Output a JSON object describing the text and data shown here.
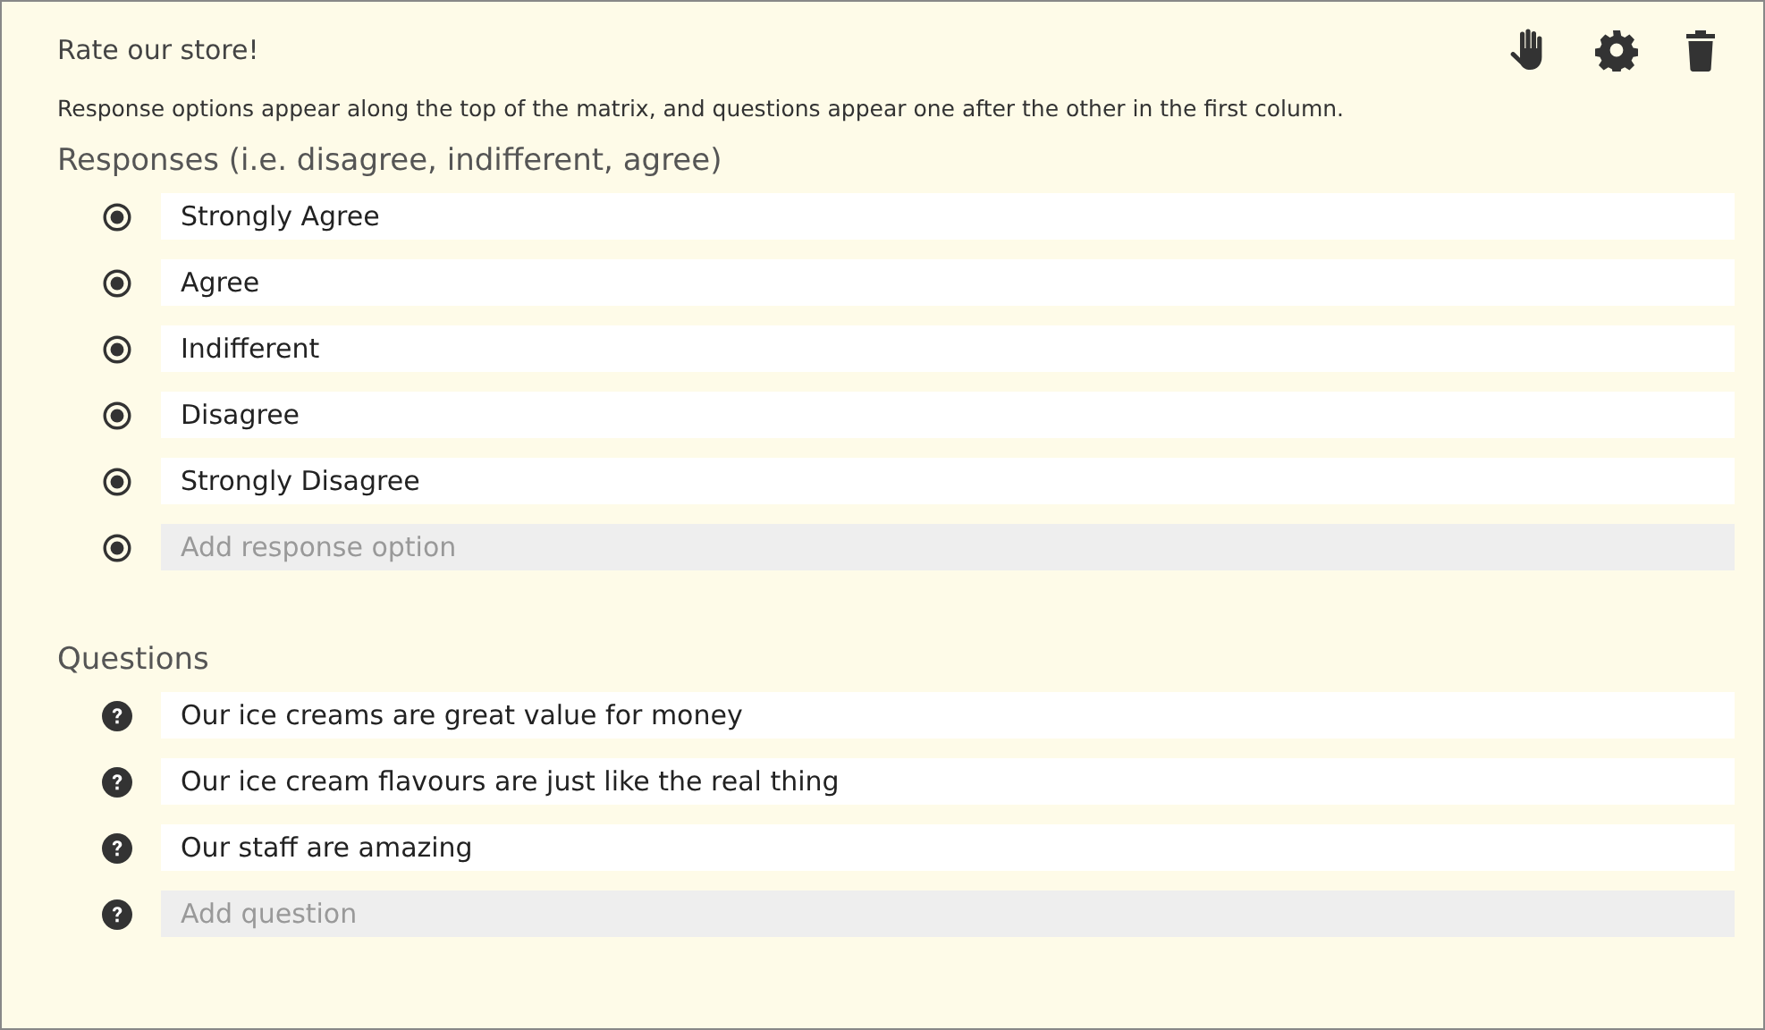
{
  "title": "Rate our store!",
  "description": "Response options appear along the top of the matrix, and questions appear one after the other in the first column.",
  "responses": {
    "heading": "Responses (i.e. disagree, indifferent, agree)",
    "options": [
      {
        "value": "Strongly Agree"
      },
      {
        "value": "Agree"
      },
      {
        "value": "Indifferent"
      },
      {
        "value": "Disagree"
      },
      {
        "value": "Strongly Disagree"
      }
    ],
    "placeholder": "Add response option"
  },
  "questions": {
    "heading": "Questions",
    "items": [
      {
        "value": "Our ice creams are great value for money"
      },
      {
        "value": "Our ice cream flavours are just like the real thing"
      },
      {
        "value": "Our staff are amazing"
      }
    ],
    "placeholder": "Add question"
  }
}
